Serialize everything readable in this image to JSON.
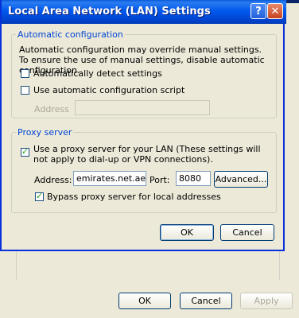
{
  "dialog": {
    "title": "Local Area Network (LAN) Settings",
    "help_glyph": "?",
    "close_glyph": "✕"
  },
  "auto_config": {
    "legend": "Automatic configuration",
    "description": "Automatic configuration may override manual settings.  To ensure the use of manual settings, disable automatic configuration.",
    "detect_label": "Automatically detect settings",
    "detect_checked": false,
    "script_label": "Use automatic configuration script",
    "script_checked": false,
    "address_label": "Address",
    "address_value": ""
  },
  "proxy": {
    "legend": "Proxy server",
    "use_proxy_label": "Use a proxy server for your LAN (These settings will not apply to dial-up or VPN connections).",
    "use_proxy_checked": true,
    "address_label": "Address:",
    "address_value": "emirates.net.ae",
    "port_label": "Port:",
    "port_value": "8080",
    "advanced_label": "Advanced...",
    "bypass_label": "Bypass proxy server for local addresses",
    "bypass_checked": true
  },
  "buttons": {
    "ok": "OK",
    "cancel": "Cancel"
  },
  "background_dialog": {
    "ok": "OK",
    "cancel": "Cancel",
    "apply": "Apply"
  },
  "colors": {
    "title_bar": "#0058ee",
    "dialog_bg": "#ece9d8",
    "group_label": "#0046d5",
    "disabled_text": "#aca899"
  }
}
